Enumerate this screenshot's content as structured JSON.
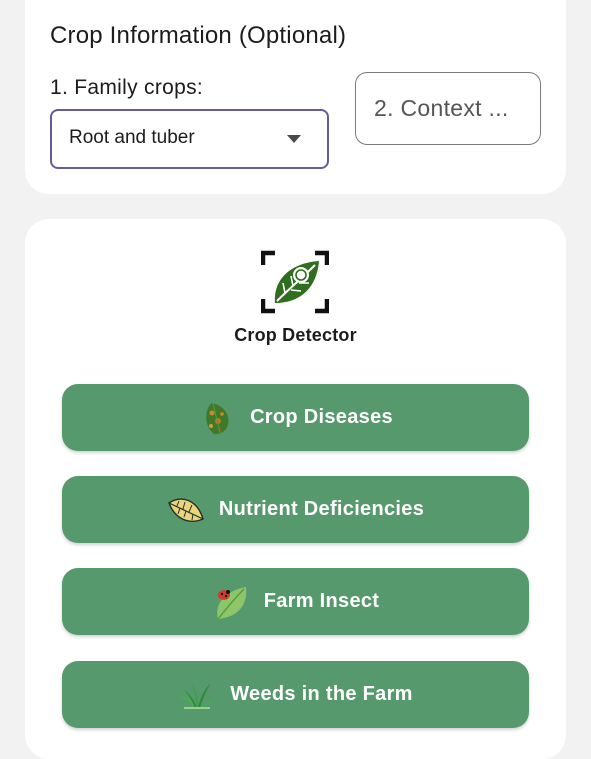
{
  "crop_info": {
    "title": "Crop Information (Optional)",
    "family_label": "1. Family crops:",
    "family_selected": "Root and tuber",
    "context_text": "2. Context ...",
    "accent_color": "#6a5a9b"
  },
  "detector": {
    "label": "Crop Detector",
    "icon": "leaf-scan-icon"
  },
  "actions": [
    {
      "label": "Crop Diseases",
      "icon": "diseased-leaf-icon"
    },
    {
      "label": "Nutrient Deficiencies",
      "icon": "yellow-leaf-icon"
    },
    {
      "label": "Farm Insect",
      "icon": "ladybug-leaf-icon"
    },
    {
      "label": "Weeds in the Farm",
      "icon": "grass-icon"
    }
  ],
  "colors": {
    "button_green": "#56996c",
    "background": "#f2f2f2",
    "card": "#ffffff"
  }
}
